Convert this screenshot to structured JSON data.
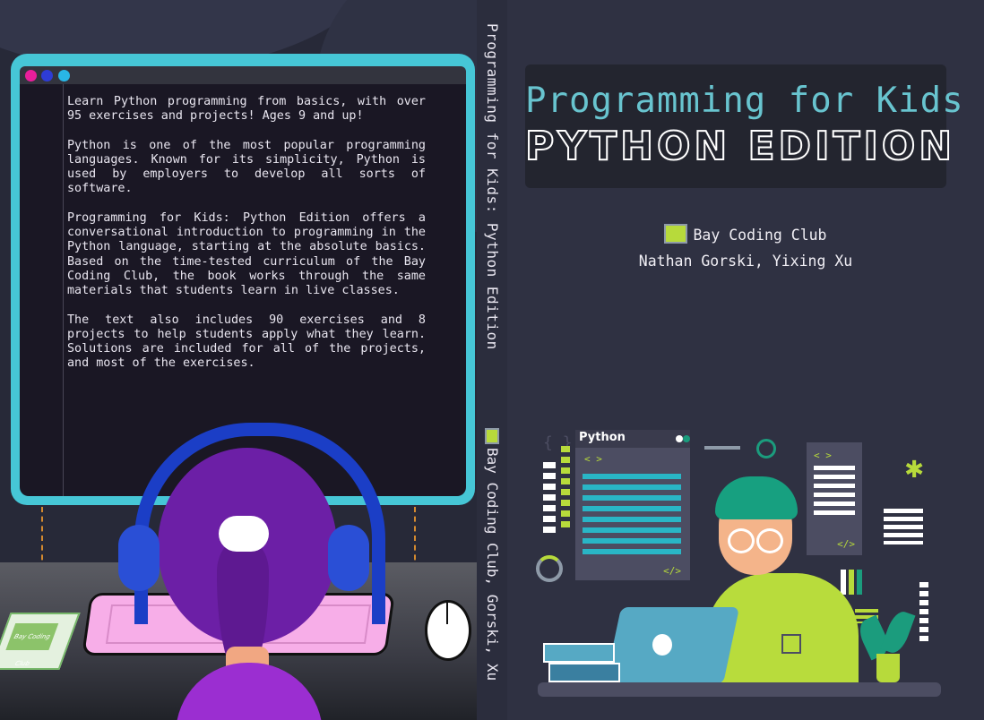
{
  "back_cover": {
    "blurb": [
      "Learn Python programming from basics, with over 95 exercises and projects! Ages 9 and up!",
      "Python is one of the most popular programming languages. Known for its simplicity, Python is used by employers to develop all sorts of software.",
      "Programming for Kids: Python Edition offers a conversational introduction to programming in the Python language, starting at the absolute basics. Based on the time-tested curriculum of the Bay Coding Club, the book works through the same materials that students learn in live classes.",
      "The text also includes 90 exercises and 8 projects to help students apply what they learn. Solutions are included for all of the projects, and most of the exercises."
    ],
    "book_label": "Bay Coding Club",
    "window_dot_colors": [
      "#e91e9b",
      "#2e3cd6",
      "#29b6e6"
    ]
  },
  "spine": {
    "title": "Programming for Kids: Python Edition",
    "author_line": "Bay Coding Club, Gorski, Xu"
  },
  "front_cover": {
    "title_line1": "Programming for Kids",
    "title_line2": "PYTHON EDITION",
    "club": "Bay Coding Club",
    "authors": "Nathan Gorski, Yixing Xu",
    "illustration": {
      "window_title": "Python",
      "open_tag": "< >",
      "close_tag": "</>",
      "bracket_tag": "{ }"
    }
  },
  "colors": {
    "accent_teal": "#68c4cf",
    "accent_lime": "#b7da3b",
    "background": "#2f3142"
  }
}
